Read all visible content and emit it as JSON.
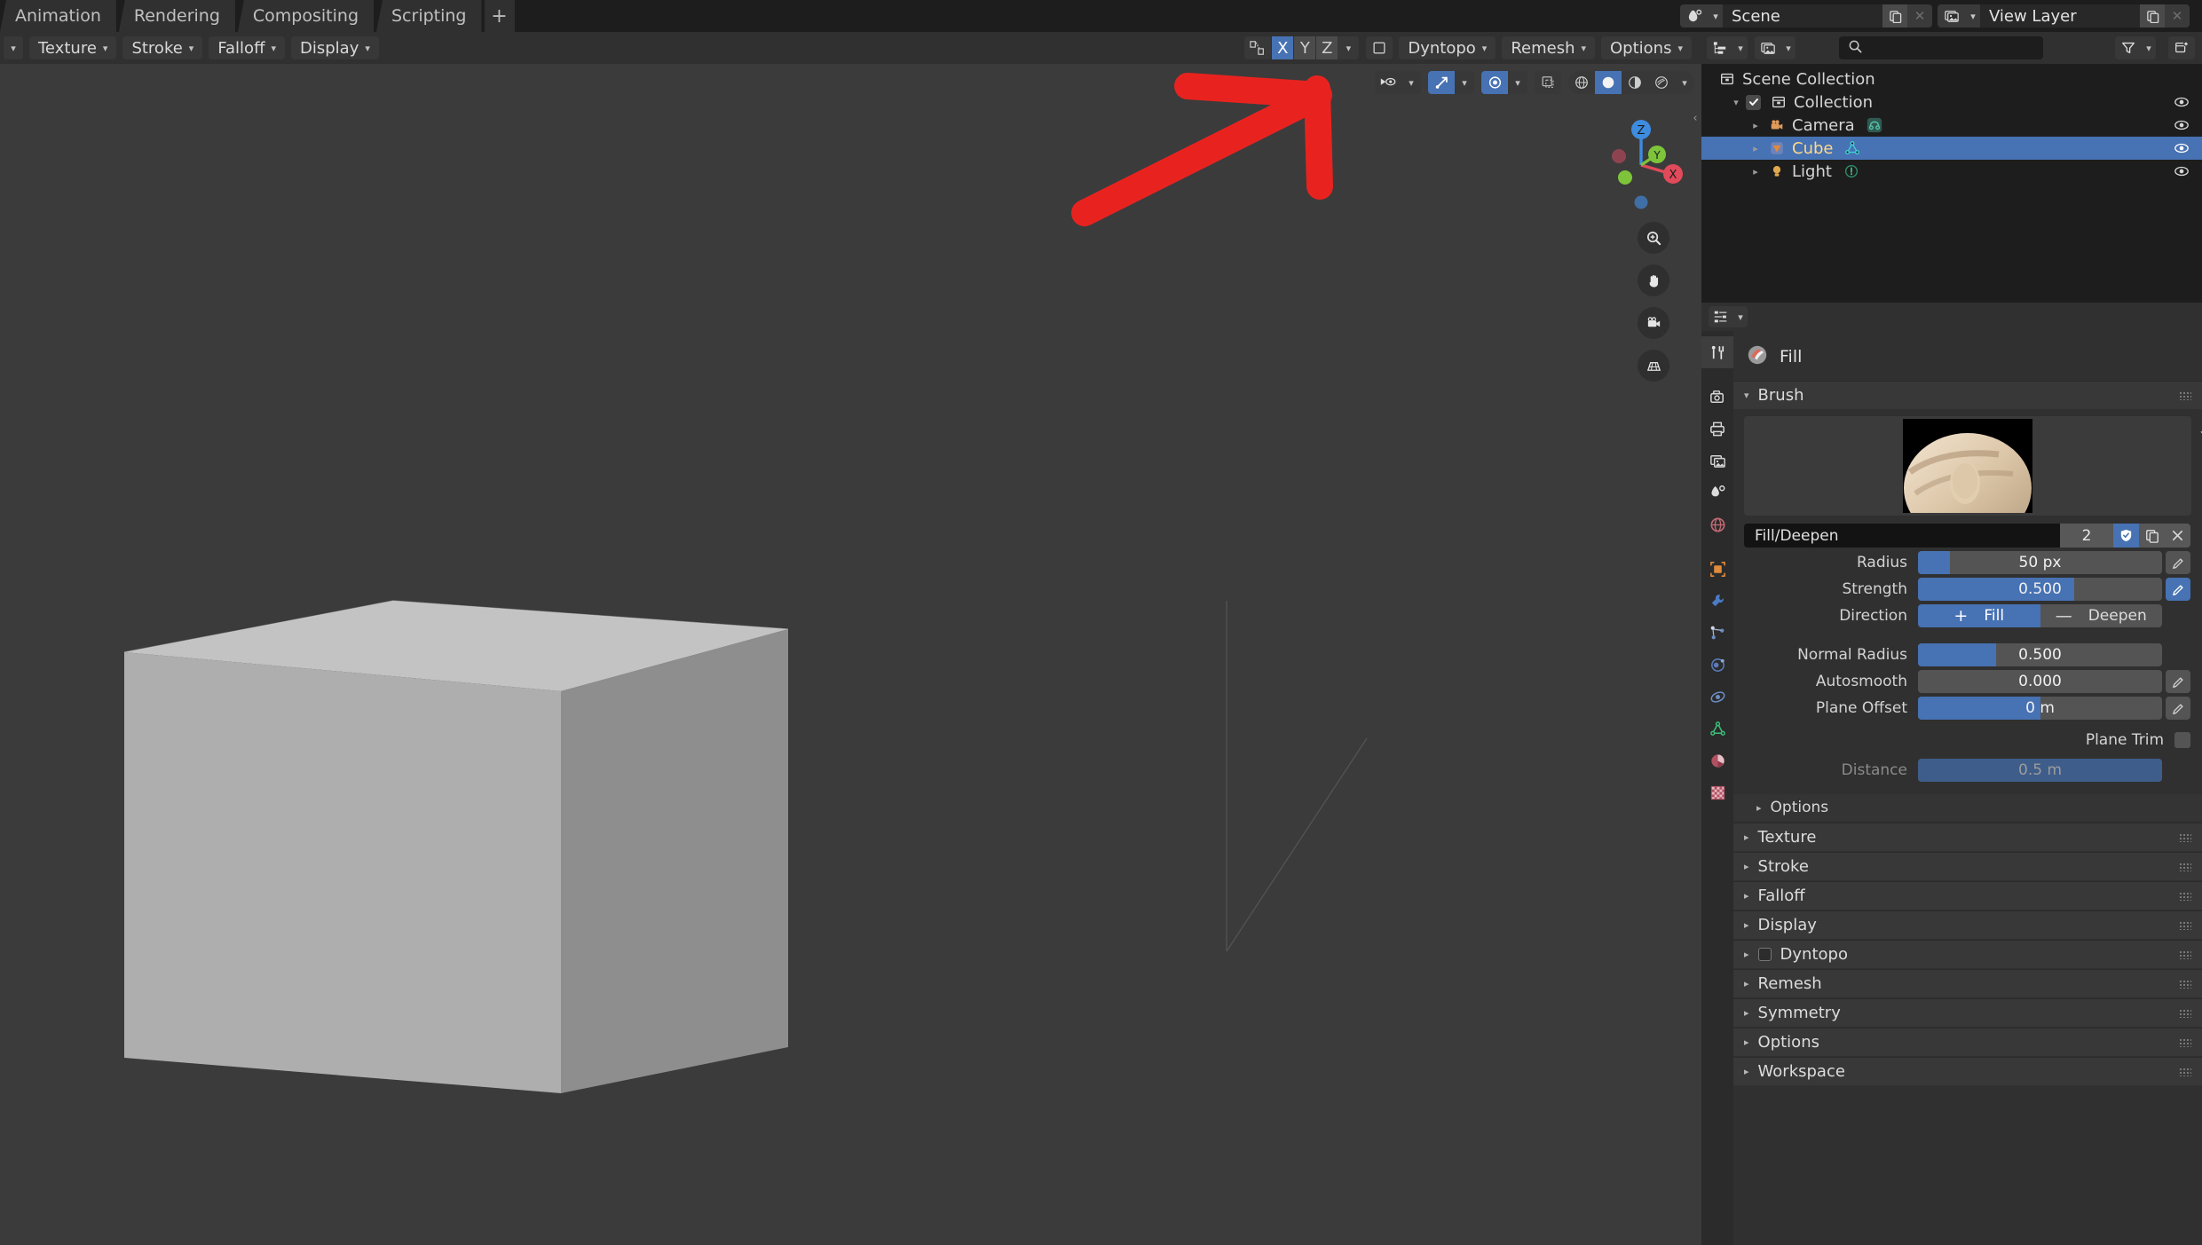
{
  "app": {
    "title": "Blender — Sculpting Workspace"
  },
  "topbar": {
    "workspace_tabs": [
      {
        "label": "Animation",
        "name": "workspace-tab-animation"
      },
      {
        "label": "Rendering",
        "name": "workspace-tab-rendering"
      },
      {
        "label": "Compositing",
        "name": "workspace-tab-compositing"
      },
      {
        "label": "Scripting",
        "name": "workspace-tab-scripting"
      }
    ],
    "add_workspace_label": "+",
    "scene": {
      "icon": "scene-icon",
      "name": "Scene",
      "new_label": "new-datablock-icon",
      "unlink_label": "unlink-icon"
    },
    "view_layer": {
      "icon": "view-layer-icon",
      "name": "View Layer",
      "new_label": "new-datablock-icon",
      "unlink_label": "unlink-icon"
    }
  },
  "viewport_header": {
    "tool_menus": [
      {
        "label": "Texture",
        "name": "menu-texture"
      },
      {
        "label": "Stroke",
        "name": "menu-stroke"
      },
      {
        "label": "Falloff",
        "name": "menu-falloff"
      },
      {
        "label": "Display",
        "name": "menu-display"
      }
    ],
    "symmetry": {
      "icon": "mirror-icon",
      "axes": [
        {
          "label": "X",
          "enabled": true
        },
        {
          "label": "Y",
          "enabled": false
        },
        {
          "label": "Z",
          "enabled": false
        }
      ]
    },
    "mask_icon": "mask-icon",
    "menus": [
      {
        "label": "Dyntopo",
        "name": "menu-dyntopo"
      },
      {
        "label": "Remesh",
        "name": "menu-remesh"
      },
      {
        "label": "Options",
        "name": "menu-options"
      }
    ]
  },
  "viewport_overlays": {
    "visibility_icon": "object-visibility-icon",
    "snap_icon": "snap-magnet-icon",
    "snap_enabled": true,
    "proportional_icon": "proportional-editing-icon",
    "proportional_enabled": true,
    "xray_icon": "xray-icon",
    "shading_modes": [
      {
        "name": "wireframe-shading",
        "enabled": false
      },
      {
        "name": "solid-shading",
        "enabled": true
      },
      {
        "name": "material-preview-shading",
        "enabled": false
      },
      {
        "name": "rendered-shading",
        "enabled": false
      }
    ],
    "gizmo": {
      "axes": [
        "X",
        "Y",
        "Z"
      ],
      "x_color": "#e04a5a",
      "y_color": "#7dc43a",
      "z_color": "#3d8ce0"
    },
    "nav_buttons": [
      {
        "name": "zoom-icon"
      },
      {
        "name": "pan-hand-icon"
      },
      {
        "name": "camera-view-icon"
      },
      {
        "name": "toggle-perspective-ortho-icon"
      }
    ]
  },
  "outliner": {
    "display_mode_icon": "outliner-display-mode-icon",
    "view_layer_icon": "view-layer-icon",
    "search": {
      "placeholder": "",
      "value": "",
      "icon": "search-icon"
    },
    "filter_icon": "filter-funnel-icon",
    "new_collection_icon": "new-collection-icon",
    "rows": [
      {
        "label": "Scene Collection",
        "icon": "collection-icon",
        "indent": 0,
        "selected": false,
        "has_triangle": false,
        "has_checkbox": false,
        "has_eye": false,
        "sub_icon": null
      },
      {
        "label": "Collection",
        "icon": "collection-icon",
        "indent": 1,
        "selected": false,
        "has_triangle": true,
        "triangle": "down",
        "has_checkbox": true,
        "checked": true,
        "has_eye": true,
        "sub_icon": null
      },
      {
        "label": "Camera",
        "icon": "camera-object-icon",
        "indent": 2,
        "selected": false,
        "has_triangle": true,
        "triangle": "right",
        "has_checkbox": false,
        "has_eye": true,
        "sub_icon": "camera-data-icon"
      },
      {
        "label": "Cube",
        "icon": "mesh-object-icon",
        "indent": 2,
        "selected": true,
        "has_triangle": true,
        "triangle": "right",
        "has_checkbox": false,
        "has_eye": true,
        "sub_icon": "mesh-data-icon"
      },
      {
        "label": "Light",
        "icon": "light-object-icon",
        "indent": 2,
        "selected": false,
        "has_triangle": true,
        "triangle": "right",
        "has_checkbox": false,
        "has_eye": true,
        "sub_icon": "light-data-icon"
      }
    ]
  },
  "properties": {
    "editor_type_icon": "properties-editor-icon",
    "tabs": [
      {
        "name": "tool-tab",
        "active": true
      },
      {
        "name": "render-tab",
        "active": false
      },
      {
        "name": "output-tab",
        "active": false
      },
      {
        "name": "view-layer-tab",
        "active": false
      },
      {
        "name": "scene-tab",
        "active": false
      },
      {
        "name": "world-tab",
        "active": false
      },
      {
        "name": "object-tab",
        "active": false
      },
      {
        "name": "modifier-tab",
        "active": false
      },
      {
        "name": "particles-tab",
        "active": false
      },
      {
        "name": "physics-tab",
        "active": false
      },
      {
        "name": "constraints-tab",
        "active": false
      },
      {
        "name": "object-data-tab",
        "active": false
      },
      {
        "name": "material-tab",
        "active": false
      },
      {
        "name": "texture-tab",
        "active": false
      }
    ],
    "tool_title": "Fill",
    "tool_icon": "brush-fill-icon",
    "brush_panel": {
      "label": "Brush",
      "expanded": true
    },
    "brush": {
      "name": "Fill/Deepen",
      "users_count": "2",
      "fake_user_icon": "shield-fake-user-icon",
      "fake_user_on": true,
      "duplicate_icon": "duplicate-icon",
      "unlink_icon": "unlink-x-icon"
    },
    "settings": [
      {
        "label": "Radius",
        "value": "50 px",
        "fill_pct": 13,
        "pen": true,
        "pen_on": false,
        "dim": false
      },
      {
        "label": "Strength",
        "value": "0.500",
        "fill_pct": 64,
        "pen": true,
        "pen_on": true,
        "dim": false
      }
    ],
    "direction": {
      "label": "Direction",
      "options": [
        {
          "sign": "+",
          "label": "Fill",
          "active": true
        },
        {
          "sign": "—",
          "label": "Deepen",
          "active": false
        }
      ]
    },
    "settings2": [
      {
        "label": "Normal Radius",
        "value": "0.500",
        "fill_pct": 32,
        "pen": false,
        "pen_on": false,
        "dim": false
      },
      {
        "label": "Autosmooth",
        "value": "0.000",
        "fill_pct": 0,
        "pen": true,
        "pen_on": false,
        "dim": false
      },
      {
        "label": "Plane Offset",
        "value": "0 m",
        "fill_pct": 50,
        "pen": true,
        "pen_on": false,
        "dim": false
      }
    ],
    "plane_trim": {
      "label": "Plane Trim",
      "checked": false
    },
    "distance": {
      "label": "Distance",
      "value": "0.5 m",
      "fill_pct": 100,
      "dim": true
    },
    "options_sub": {
      "label": "Options"
    },
    "panels": [
      {
        "label": "Texture",
        "name": "panel-texture",
        "checkbox": false
      },
      {
        "label": "Stroke",
        "name": "panel-stroke",
        "checkbox": false
      },
      {
        "label": "Falloff",
        "name": "panel-falloff",
        "checkbox": false
      },
      {
        "label": "Display",
        "name": "panel-display",
        "checkbox": false
      },
      {
        "label": "Dyntopo",
        "name": "panel-dyntopo",
        "checkbox": true
      },
      {
        "label": "Remesh",
        "name": "panel-remesh",
        "checkbox": false
      },
      {
        "label": "Symmetry",
        "name": "panel-symmetry",
        "checkbox": false
      },
      {
        "label": "Options",
        "name": "panel-options",
        "checkbox": false
      },
      {
        "label": "Workspace",
        "name": "panel-workspace",
        "checkbox": false
      }
    ]
  },
  "annotation": {
    "color": "#e8231f",
    "shape": "arrow-pointing-up-right"
  },
  "colors": {
    "accent_blue": "#4772b3",
    "panel_bg": "#303030",
    "editor_bg": "#1d1d1d",
    "viewport_bg": "#3b3b3b",
    "selected_text": "#ffd98a"
  }
}
